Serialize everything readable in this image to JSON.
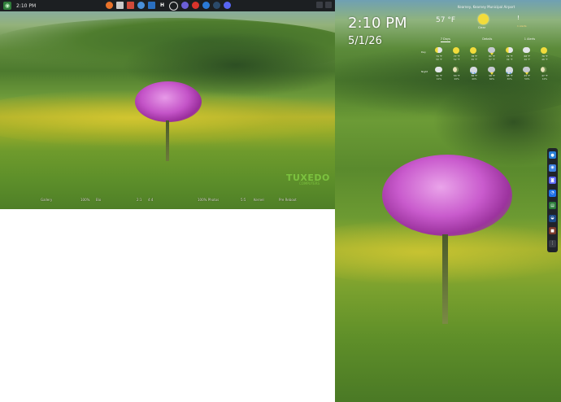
{
  "left_monitor": {
    "clock": "2:10 PM",
    "launcher_icon": "menu-icon",
    "taskbar_icons": [
      "firefox-icon",
      "files-icon",
      "settings-icon",
      "chrome-icon",
      "app-icon",
      "h-icon",
      "clock-icon",
      "bluetooth-icon",
      "network-icon",
      "dropbox-icon",
      "steam-icon",
      "discord-icon"
    ],
    "h_label": "H",
    "desktop_labels": [
      "Gallery",
      "100%",
      "Bio",
      "2:1",
      "4:4",
      "100% Photos",
      "5:5",
      "Kernel",
      "Pre Reboot"
    ],
    "wallpaper_brand": "TUXEDO",
    "wallpaper_brand_sub": "COMPUTERS"
  },
  "right_monitor": {
    "clock": "2:10 PM",
    "date": "5/1/26",
    "weather": {
      "location": "Kearney, Kearney Municipal Airport",
      "temperature": "57 °F",
      "condition": "Clear",
      "alert_icon": "!",
      "alert_text": "1 Alerts",
      "tabs": [
        "7 Days",
        "Details",
        "1 Alerts"
      ],
      "active_tab": 0,
      "rows": [
        {
          "label": "Day",
          "days": [
            {
              "icon": "partly",
              "hi": "74 °F",
              "lo": "50 °F"
            },
            {
              "icon": "sun",
              "hi": "77 °F",
              "lo": "52 °F"
            },
            {
              "icon": "sun",
              "hi": "78 °F",
              "lo": "55 °F"
            },
            {
              "icon": "storm",
              "hi": "81 °F",
              "lo": "57 °F"
            },
            {
              "icon": "partly",
              "hi": "72 °F",
              "lo": "49 °F"
            },
            {
              "icon": "cloud",
              "hi": "68 °F",
              "lo": "46 °F"
            },
            {
              "icon": "sun",
              "hi": "70 °F",
              "lo": "48 °F"
            }
          ]
        },
        {
          "label": "Night",
          "days": [
            {
              "icon": "cloud",
              "hi": "51 °F",
              "lo": "10%"
            },
            {
              "icon": "moon",
              "hi": "53 °F",
              "lo": "20%"
            },
            {
              "icon": "rain",
              "hi": "56 °F",
              "lo": "40%"
            },
            {
              "icon": "storm",
              "hi": "58 °F",
              "lo": "60%"
            },
            {
              "icon": "rain",
              "hi": "48 °F",
              "lo": "30%"
            },
            {
              "icon": "storm",
              "hi": "45 °F",
              "lo": "50%"
            },
            {
              "icon": "moon",
              "hi": "47 °F",
              "lo": "10%"
            }
          ]
        }
      ]
    },
    "dock_icons": [
      {
        "name": "firefox-icon",
        "color": "#2a7fd6",
        "glyph": "●"
      },
      {
        "name": "chrome-icon",
        "color": "#3d7fe0",
        "glyph": "◉"
      },
      {
        "name": "discord-icon",
        "color": "#5865f2",
        "glyph": "◙"
      },
      {
        "name": "messenger-icon",
        "color": "#1d6fe8",
        "glyph": "◔"
      },
      {
        "name": "terminal-icon",
        "color": "#2b7d3a",
        "glyph": "▤"
      },
      {
        "name": "steam-icon",
        "color": "#1b4a8a",
        "glyph": "◒"
      },
      {
        "name": "app-icon",
        "color": "#7a3a2a",
        "glyph": "■"
      },
      {
        "name": "apps-grid-icon",
        "color": "#3a3d44",
        "glyph": "⋮"
      }
    ]
  }
}
